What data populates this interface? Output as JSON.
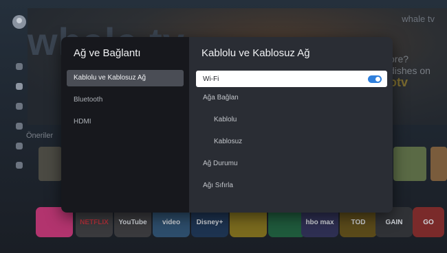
{
  "background": {
    "brand": "whale tv",
    "hero_logo": "whale tv",
    "promo_line1": "ore?",
    "promo_line2": "dishes on",
    "promo_line3": "otv",
    "row_label": "Öneriler",
    "apps": [
      "NETFLIX",
      "YouTube",
      "video",
      "Disney+",
      "",
      "",
      "hbo max",
      "TOD",
      "GAIN",
      "GO"
    ]
  },
  "dialog": {
    "left_title": "Ağ ve Bağlantı",
    "left_items": [
      {
        "label": "Kablolu ve Kablosuz Ağ",
        "selected": true
      },
      {
        "label": "Bluetooth",
        "selected": false
      },
      {
        "label": "HDMI",
        "selected": false
      }
    ],
    "right_title": "Kablolu ve Kablosuz Ağ",
    "wifi": {
      "label": "Wi-Fi",
      "enabled": true
    },
    "right_items": [
      {
        "label": "Ağa Bağlan"
      },
      {
        "label": "Kablolu"
      },
      {
        "label": "Kablosuz"
      },
      {
        "label": "Ağ Durumu"
      },
      {
        "label": "Ağı Sıfırla"
      }
    ]
  },
  "colors": {
    "accent": "#2f7fdc",
    "dialog_left": "#17181d",
    "dialog_right": "#2a2d34",
    "selection": "#4a4d55"
  }
}
